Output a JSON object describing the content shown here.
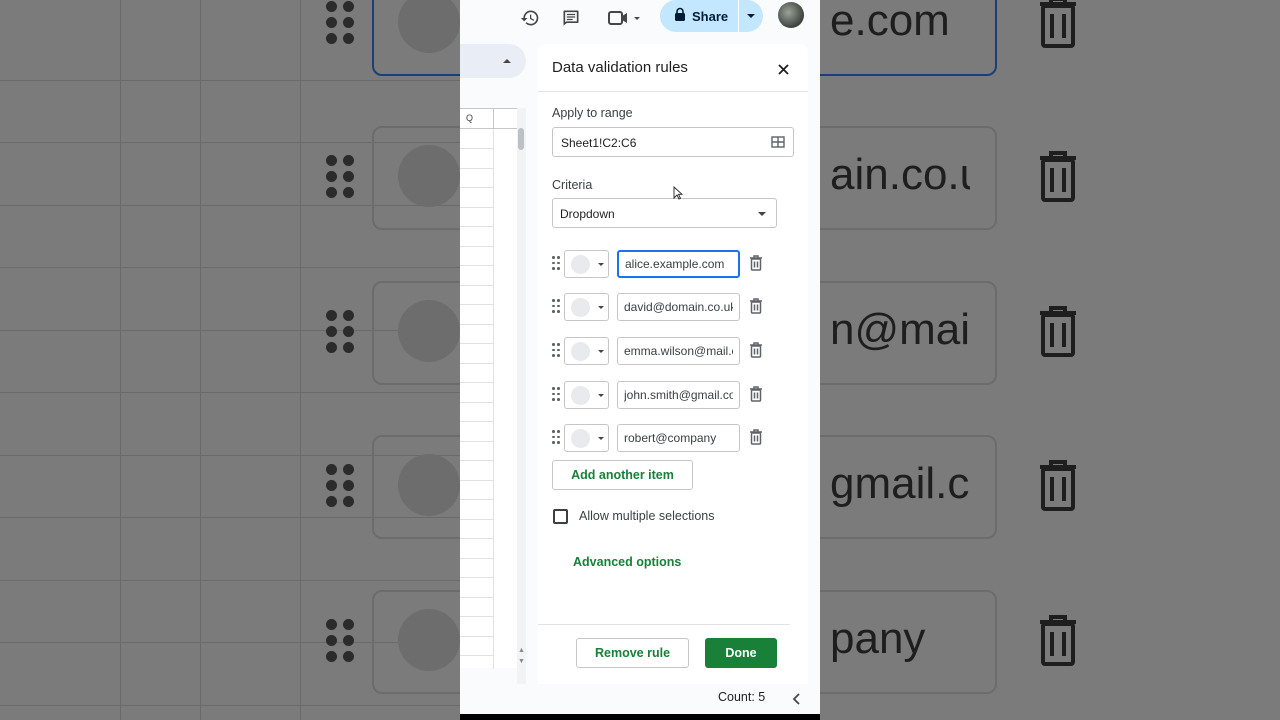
{
  "toolbar": {
    "history_icon": "history-icon",
    "comment_icon": "comment-icon",
    "meet_icon": "video-camera-icon",
    "share_label": "Share",
    "lock_icon": "lock-icon"
  },
  "sheet": {
    "column_header": "Q"
  },
  "panel": {
    "title": "Data validation rules",
    "apply_range_label": "Apply to range",
    "range_value": "Sheet1!C2:C6",
    "criteria_label": "Criteria",
    "criteria_value": "Dropdown",
    "items": [
      {
        "value": "alice.example.com"
      },
      {
        "value": "david@domain.co.uk"
      },
      {
        "value": "emma.wilson@mail.com"
      },
      {
        "value": "john.smith@gmail.com"
      },
      {
        "value": "robert@company"
      }
    ],
    "add_item_label": "Add another item",
    "allow_multiple_label": "Allow multiple selections",
    "allow_multiple_checked": false,
    "advanced_options_label": "Advanced options",
    "remove_rule_label": "Remove rule",
    "done_label": "Done"
  },
  "status": {
    "count_text": "Count: 5"
  },
  "background": {
    "texts": [
      "e.com",
      "ain.co.uk",
      "n@mail.c",
      "gmail.cc",
      "pany"
    ]
  },
  "colors": {
    "accent_green": "#188038",
    "share_bg": "#c2e7ff",
    "focus_blue": "#1a73e8"
  }
}
